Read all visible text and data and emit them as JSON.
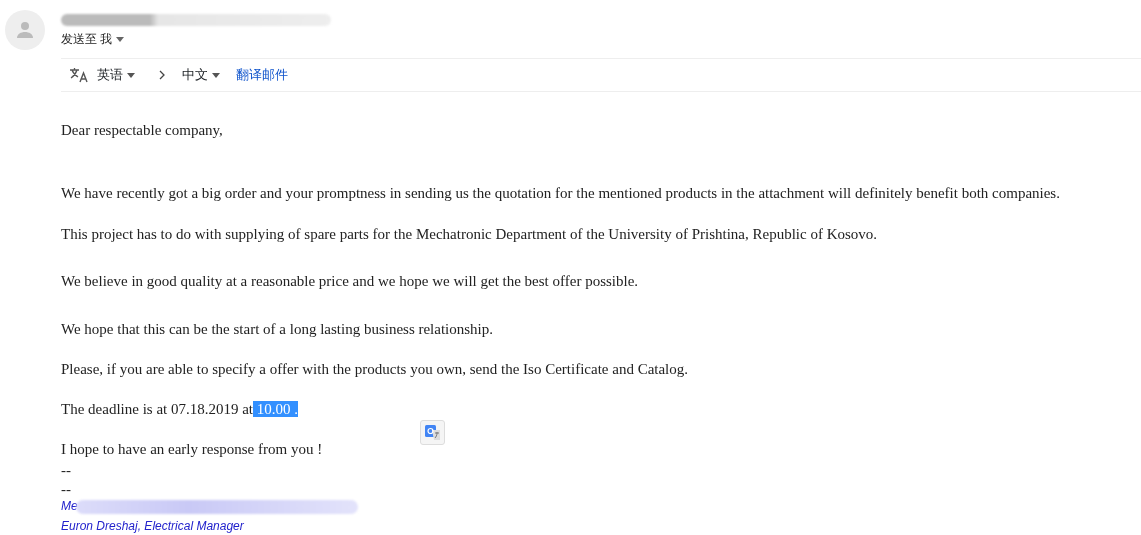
{
  "header": {
    "recipient_label": "发送至 我"
  },
  "translate_bar": {
    "source_language": "英语",
    "target_language": "中文",
    "action": "翻译邮件"
  },
  "body": [
    {
      "text": "Dear respectable company,"
    },
    {
      "text": "We have recently got a big order and your promptness in sending us the quotation for the mentioned products in the attachment will definitely benefit both companies."
    },
    {
      "text": "This project has to do with supplying of spare parts for the Mechatronic Department of the University of Prishtina, Republic of Kosovo."
    },
    {
      "text": "We believe in good quality at a reasonable price and we hope we will get the best offer possible."
    },
    {
      "text": "We hope that this can be the start of a long lasting business relationship."
    },
    {
      "text": "Please, if you are able to specify a offer with the products you own, send the Iso Certificate and Catalog."
    },
    {
      "text": "The deadline is at 07.18.2019 at",
      "selected_text": " 10.00 ."
    },
    {
      "text": "I hope to have an early response from you !"
    },
    {
      "text": "--"
    }
  ],
  "signature": {
    "separator": "--",
    "line_1": "Me",
    "line_2": "Euron Dreshaj, Electrical Manager"
  }
}
